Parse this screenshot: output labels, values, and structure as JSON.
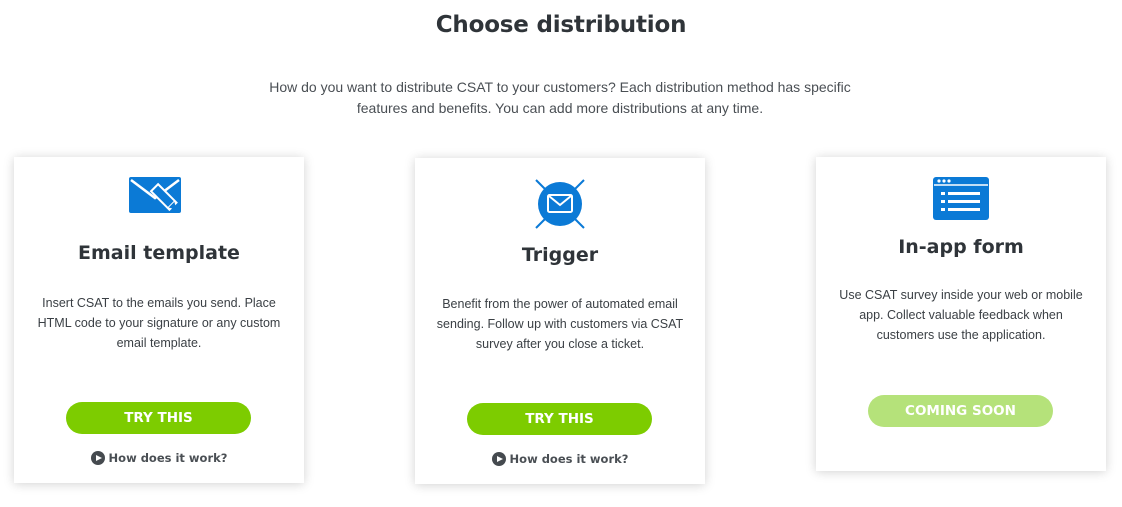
{
  "header": {
    "title": "Choose distribution",
    "subtitle": "How do you want to distribute CSAT to your customers? Each distribution method has specific features and benefits. You can add more distributions at any time."
  },
  "colors": {
    "accent": "#0b7ad6",
    "button": "#7dcc00",
    "button_disabled": "#b5e27a"
  },
  "cards": [
    {
      "icon": "email-pencil-icon",
      "title": "Email template",
      "description": "Insert CSAT to the emails you send. Place HTML code to your signature or any custom email template.",
      "button": "TRY THIS",
      "link": "How does it work?"
    },
    {
      "icon": "trigger-envelope-icon",
      "title": "Trigger",
      "description": "Benefit from the power of automated email sending. Follow up with customers via CSAT survey after you close a ticket.",
      "button": "TRY THIS",
      "link": "How does it work?"
    },
    {
      "icon": "browser-form-icon",
      "title": "In-app form",
      "description": "Use CSAT survey inside your web or mobile app. Collect valuable feedback when customers use the application.",
      "button": "COMING SOON"
    }
  ]
}
